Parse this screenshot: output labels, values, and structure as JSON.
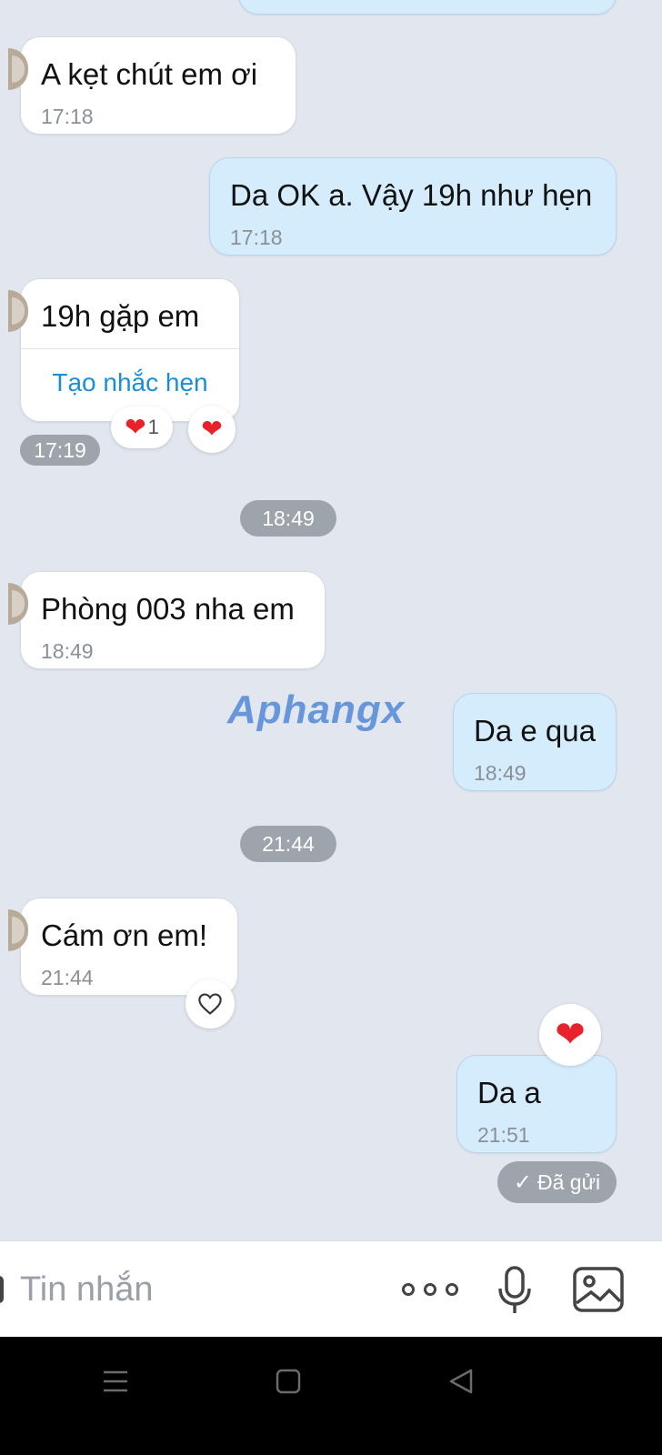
{
  "messages": [
    {
      "id": "m1",
      "side": "in",
      "text": "A kẹt chút em ơi",
      "time": "17:18"
    },
    {
      "id": "m2",
      "side": "out",
      "text": "Da OK a. Vậy 19h như hẹn",
      "time": "17:18"
    },
    {
      "id": "m3",
      "side": "in",
      "text": "19h gặp em",
      "action": "Tạo nhắc hẹn",
      "time": "17:19",
      "reaction_count": "1"
    },
    {
      "id": "m4",
      "side": "in",
      "text": "Phòng 003 nha em",
      "time": "18:49"
    },
    {
      "id": "m5",
      "side": "out",
      "text": "Da e qua",
      "time": "18:49"
    },
    {
      "id": "m6",
      "side": "in",
      "text": "Cám ơn em!",
      "time": "21:44"
    },
    {
      "id": "m7",
      "side": "out",
      "text": "Da a",
      "time": "21:51"
    }
  ],
  "separators": {
    "s1": "18:49",
    "s2": "21:44"
  },
  "status": {
    "sent": "Đã gửi"
  },
  "watermark": "Aphangx",
  "composer": {
    "placeholder": "Tin nhắn"
  },
  "icons": {
    "more": "more-dots-icon",
    "mic": "microphone-icon",
    "image": "image-icon",
    "nav_menu": "menu-icon",
    "nav_home": "home-icon",
    "nav_back": "back-icon"
  },
  "colors": {
    "incoming": "#ffffff",
    "outgoing": "#d5ecfc",
    "background": "#e2e7ef",
    "link": "#1a8fd6",
    "heart": "#e8222a"
  }
}
